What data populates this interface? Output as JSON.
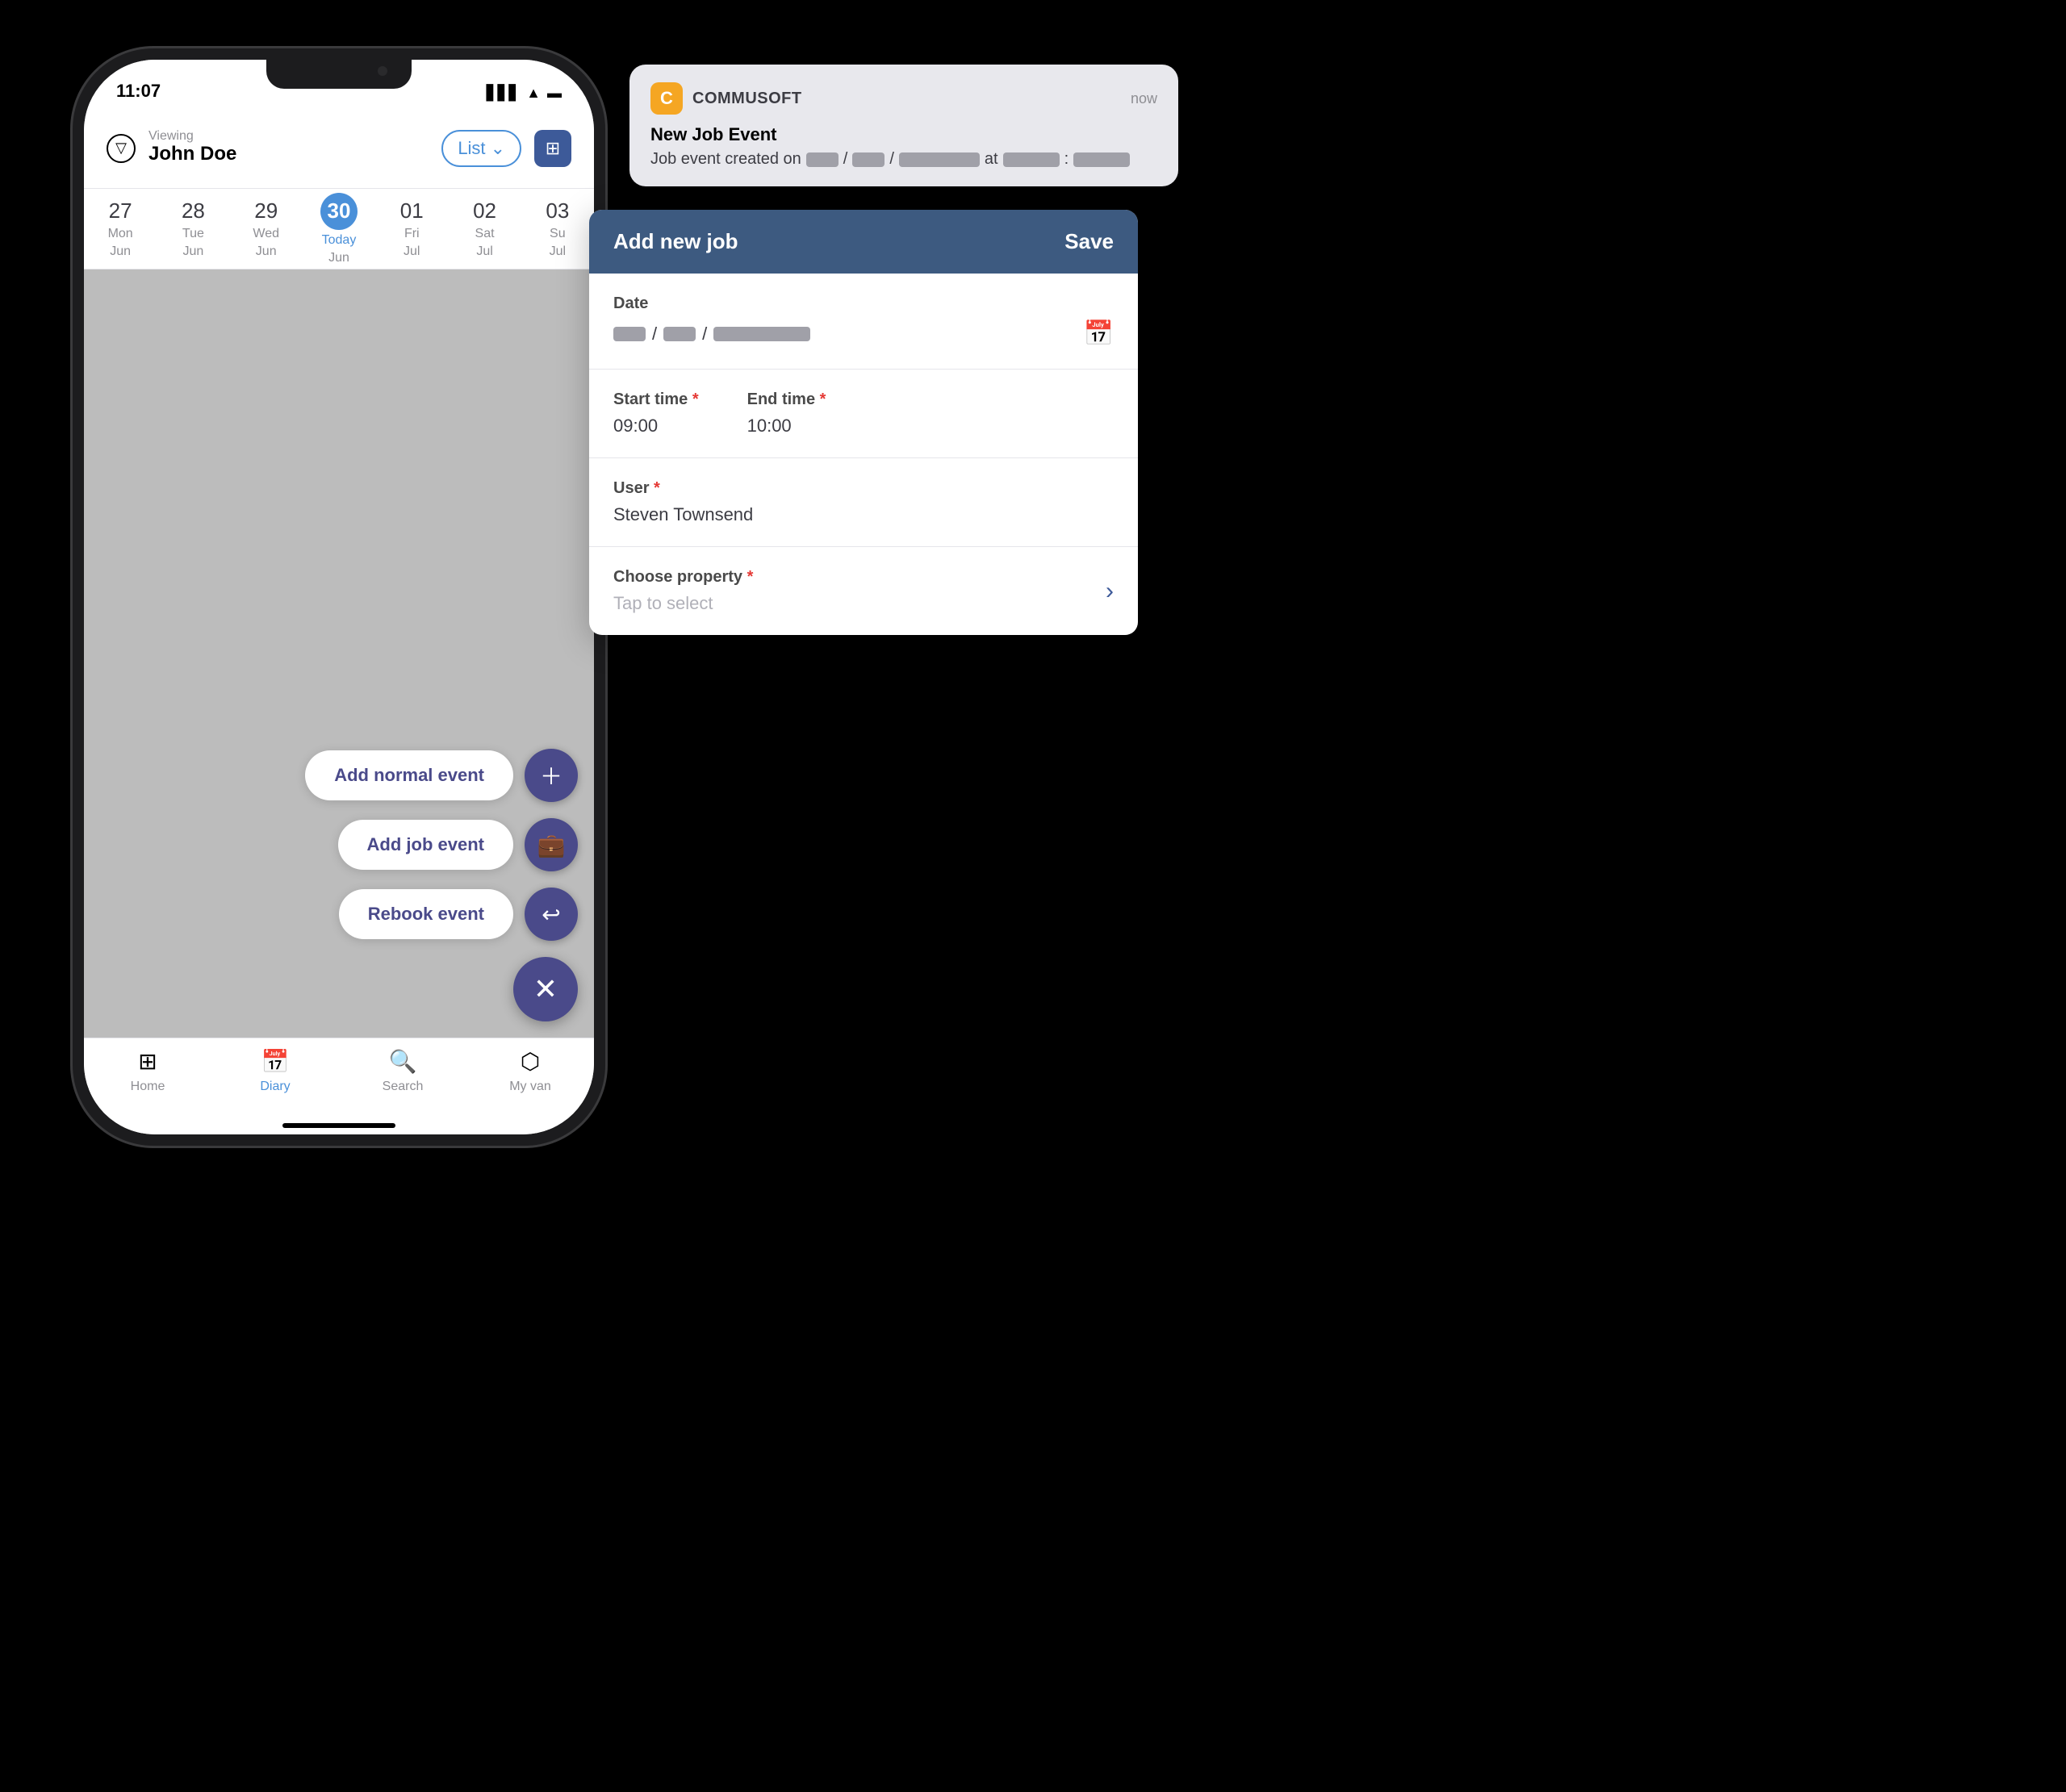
{
  "statusBar": {
    "time": "11:07",
    "icons": [
      "▋▋▋",
      "WiFi",
      "🔋"
    ]
  },
  "header": {
    "viewingLabel": "Viewing",
    "viewingName": "John Doe",
    "listToggle": "List",
    "calendarIcon": "📅"
  },
  "calendarDays": [
    {
      "num": "27",
      "name": "Mon",
      "month": "Jun",
      "today": false
    },
    {
      "num": "28",
      "name": "Tue",
      "month": "Jun",
      "today": false
    },
    {
      "num": "29",
      "name": "Wed",
      "month": "Jun",
      "today": false
    },
    {
      "num": "30",
      "name": "Today",
      "month": "Jun",
      "today": true
    },
    {
      "num": "01",
      "name": "Fri",
      "month": "Jul",
      "today": false
    },
    {
      "num": "02",
      "name": "Sat",
      "month": "Jul",
      "today": false
    },
    {
      "num": "03",
      "name": "Su",
      "month": "Jul",
      "today": false
    }
  ],
  "fabOptions": [
    {
      "label": "Add normal event",
      "icon": "+"
    },
    {
      "label": "Add job event",
      "icon": "💼"
    },
    {
      "label": "Rebook event",
      "icon": "↩"
    }
  ],
  "closeIcon": "✕",
  "bottomNav": [
    {
      "label": "Home",
      "icon": "⊞",
      "active": false
    },
    {
      "label": "Diary",
      "icon": "📅",
      "active": true
    },
    {
      "label": "Search",
      "icon": "🔍",
      "active": false
    },
    {
      "label": "My van",
      "icon": "⬡",
      "active": false
    }
  ],
  "notification": {
    "appName": "COMMUSOFT",
    "time": "now",
    "title": "New Job Event",
    "bodyPrefix": "Job event created on",
    "bodySuffix": "at"
  },
  "jobPanel": {
    "title": "Add new job",
    "saveLabel": "Save",
    "fields": {
      "date": {
        "label": "Date",
        "value": ""
      },
      "startTime": {
        "label": "Start time",
        "required": true,
        "value": "09:00"
      },
      "endTime": {
        "label": "End time",
        "required": true,
        "value": "10:00"
      },
      "user": {
        "label": "User",
        "required": true,
        "value": "Steven Townsend"
      },
      "property": {
        "label": "Choose property",
        "required": true,
        "placeholder": "Tap to select"
      }
    }
  }
}
